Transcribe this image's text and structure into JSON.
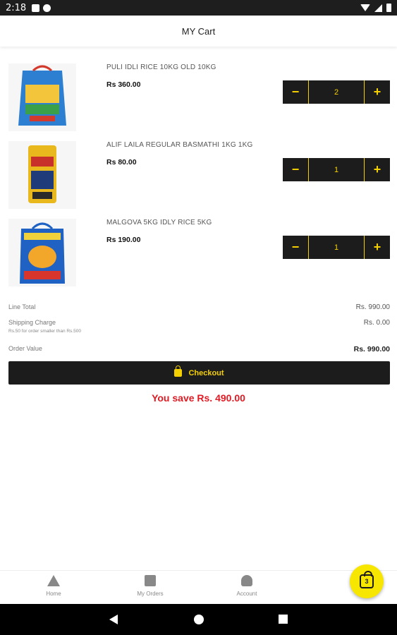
{
  "status_bar": {
    "time": "2:18"
  },
  "header": {
    "title": "MY Cart"
  },
  "items": [
    {
      "name": "PULI IDLI RICE 10KG OLD 10KG",
      "price": "Rs 360.00",
      "qty": "2",
      "image": "rice-bag-blue-icon"
    },
    {
      "name": "ALIF LAILA REGULAR BASMATHI 1KG 1KG",
      "price": "Rs 80.00",
      "qty": "1",
      "image": "rice-bag-yellow-icon"
    },
    {
      "name": "MALGOVA 5KG IDLY RICE 5KG",
      "price": "Rs 190.00",
      "qty": "1",
      "image": "rice-bag-mango-icon"
    }
  ],
  "stepper": {
    "minus": "−",
    "plus": "+"
  },
  "totals": {
    "line_total_label": "Line Total",
    "line_total_value": "Rs. 990.00",
    "shipping_label": "Shipping Charge",
    "shipping_note": "Rs.50 for order smaller than Rs.500",
    "shipping_value": "Rs. 0.00",
    "order_value_label": "Order Value",
    "order_value_value": "Rs. 990.00"
  },
  "checkout": {
    "label": "Checkout"
  },
  "savings": {
    "text": "You save Rs. 490.00"
  },
  "bottom_nav": {
    "home": "Home",
    "orders": "My Orders",
    "account": "Account",
    "cart_count": "3"
  },
  "colors": {
    "accent": "#f5d000",
    "dark": "#1c1c1c",
    "savings": "#e01b24"
  }
}
